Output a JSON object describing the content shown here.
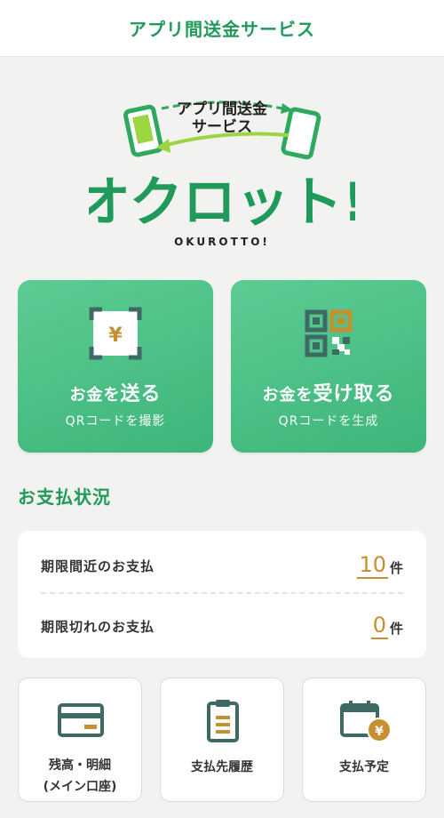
{
  "header": {
    "title": "アプリ間送金サービス"
  },
  "logo": {
    "tagline_line1": "アプリ間送金",
    "tagline_line2": "サービス",
    "brand": "オクロット!",
    "romaji": "OKUROTTO!"
  },
  "actions": {
    "send": {
      "title_small": "お金を",
      "title_big": "送る",
      "subtitle": "QRコードを撮影",
      "icon": "yen-scan-icon"
    },
    "receive": {
      "title_small": "お金を",
      "title_big": "受け取る",
      "subtitle": "QRコードを生成",
      "icon": "qr-code-icon"
    }
  },
  "payment_status": {
    "title": "お支払状況",
    "rows": [
      {
        "label": "期限間近のお支払",
        "count": "10",
        "unit": "件"
      },
      {
        "label": "期限切れのお支払",
        "count": "0",
        "unit": "件"
      }
    ]
  },
  "menu": [
    {
      "line1": "残高・明細",
      "line2": "(メイン口座)",
      "icon": "card-icon"
    },
    {
      "line1": "支払先履歴",
      "icon": "clipboard-icon"
    },
    {
      "line1": "支払予定",
      "icon": "calendar-yen-icon"
    }
  ],
  "colors": {
    "brand_green": "#1f9a5a",
    "card_green": "#4cc086",
    "accent_gold": "#c69030",
    "icon_teal": "#3f6a63"
  }
}
